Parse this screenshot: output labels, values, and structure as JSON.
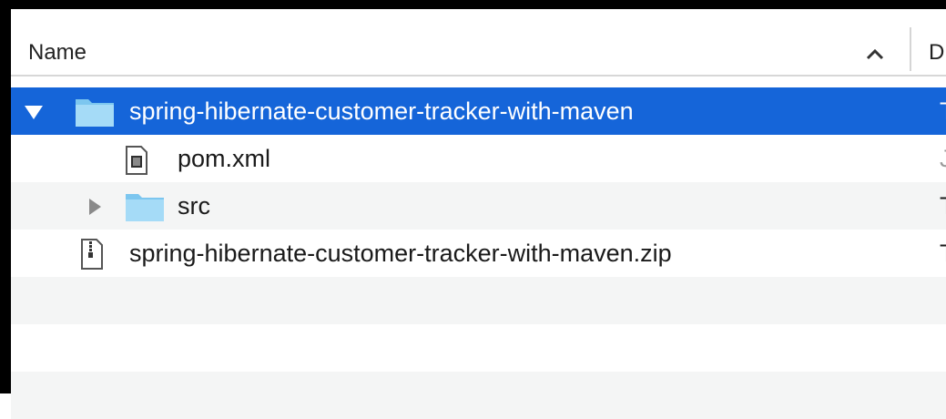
{
  "header": {
    "name_label": "Name",
    "next_column_partial": "D"
  },
  "rows": [
    {
      "name": "spring-hibernate-customer-tracker-with-maven",
      "icon": "folder-icon",
      "expanded": true,
      "selected": true,
      "trail": "T"
    },
    {
      "name": "pom.xml",
      "icon": "xml-file-icon",
      "trail": "J"
    },
    {
      "name": "src",
      "icon": "folder-icon",
      "expanded": false,
      "trail": "T"
    },
    {
      "name": "spring-hibernate-customer-tracker-with-maven.zip",
      "icon": "zip-file-icon",
      "trail": "T"
    }
  ],
  "colors": {
    "selection": "#1565d9",
    "folder": "#8ccdf2",
    "alt_row": "#f4f5f5"
  }
}
